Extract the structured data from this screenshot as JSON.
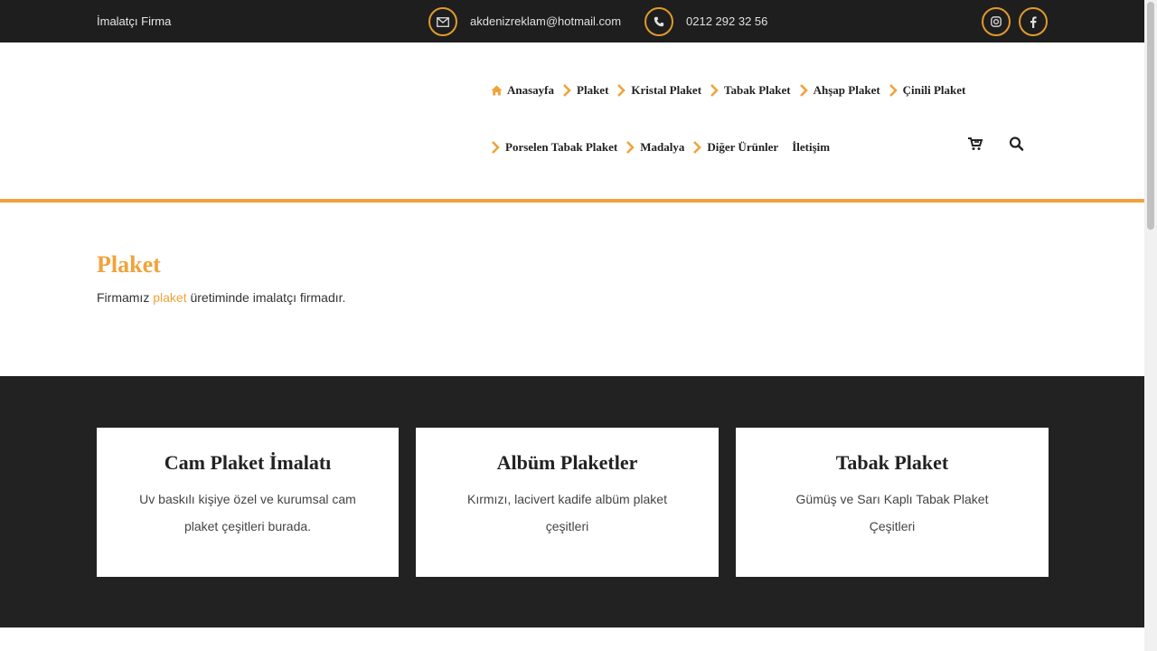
{
  "topbar": {
    "brand": "İmalatçı Firma",
    "email": "akdenizreklam@hotmail.com",
    "phone": "0212 292 32 56",
    "icons": [
      "envelope-icon",
      "phone-icon",
      "instagram-icon",
      "facebook-icon"
    ]
  },
  "nav": {
    "home": "Anasayfa",
    "row1": [
      "Plaket",
      "Kristal Plaket",
      "Tabak Plaket",
      "Ahşap Plaket",
      "Çinili Plaket"
    ],
    "row2": [
      "Porselen Tabak Plaket",
      "Madalya",
      "Diğer Ürünler"
    ],
    "contact": "İletişim",
    "icons": [
      "cart-icon",
      "search-icon"
    ]
  },
  "content": {
    "title": "Plaket",
    "intro_before": "Firmamız ",
    "intro_link": "plaket",
    "intro_after": " üretiminde imalatçı firmadır."
  },
  "cards": [
    {
      "title": "Cam Plaket İmalatı",
      "text": "Uv baskılı kişiye özel ve kurumsal cam plaket çeşitleri burada."
    },
    {
      "title": "Albüm Plaketler",
      "text": "Kırmızı, lacivert kadife albüm plaket çeşitleri"
    },
    {
      "title": "Tabak Plaket",
      "text": "Gümüş ve Sarı Kaplı Tabak Plaket Çeşitleri"
    }
  ],
  "colors": {
    "accent": "#f0a33a",
    "dark": "#1e1e1e"
  }
}
